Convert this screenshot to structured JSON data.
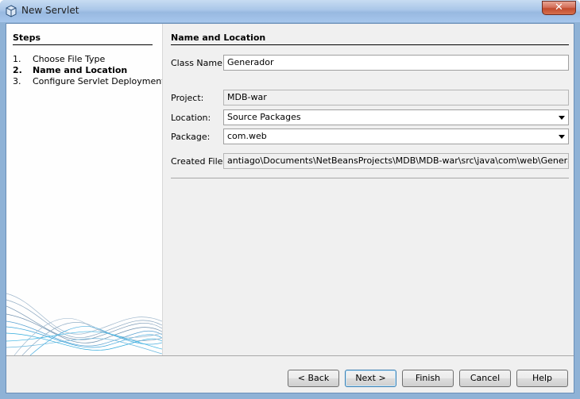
{
  "window": {
    "title": "New Servlet",
    "close_label": "✕"
  },
  "steps": {
    "title": "Steps",
    "items": [
      {
        "num": "1.",
        "label": "Choose File Type"
      },
      {
        "num": "2.",
        "label": "Name and Location"
      },
      {
        "num": "3.",
        "label": "Configure Servlet Deployment"
      }
    ],
    "active_index": 1
  },
  "panel": {
    "title": "Name and Location",
    "class_name": {
      "label": "Class Name:",
      "value": "Generador"
    },
    "project": {
      "label": "Project:",
      "value": "MDB-war"
    },
    "location": {
      "label": "Location:",
      "value": "Source Packages"
    },
    "package": {
      "label": "Package:",
      "value": "com.web"
    },
    "created_file": {
      "label": "Created File:",
      "value": "antiago\\Documents\\NetBeansProjects\\MDB\\MDB-war\\src\\java\\com\\web\\Generador.java"
    }
  },
  "buttons": {
    "back": "< Back",
    "next": "Next >",
    "finish": "Finish",
    "cancel": "Cancel",
    "help": "Help"
  },
  "colors": {
    "accent": "#3c7fb1",
    "titlebar": "#a9c6e8",
    "close": "#c24b2e"
  }
}
